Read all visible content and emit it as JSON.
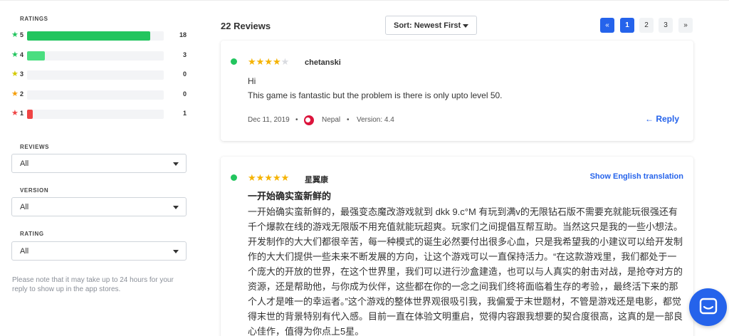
{
  "sidebar": {
    "ratings_label": "RATINGS",
    "ratings": [
      {
        "stars": "5",
        "count": "18",
        "fraction": 0.9,
        "color": "#22c55e"
      },
      {
        "stars": "4",
        "count": "3",
        "fraction": 0.13,
        "color": "#4ade80"
      },
      {
        "stars": "3",
        "count": "0",
        "fraction": 0,
        "color": "#facc15"
      },
      {
        "stars": "2",
        "count": "0",
        "fraction": 0,
        "color": "#fb923c"
      },
      {
        "stars": "1",
        "count": "1",
        "fraction": 0.04,
        "color": "#ef4444"
      }
    ],
    "filters": {
      "reviews": {
        "label": "REVIEWS",
        "value": "All"
      },
      "version": {
        "label": "VERSION",
        "value": "All"
      },
      "rating": {
        "label": "RATING",
        "value": "All"
      }
    },
    "note": "Please note that it may take up to 24 hours for your reply to show up in the app stores."
  },
  "main": {
    "reviews_count": "22 Reviews",
    "sort": "Sort: Newest First",
    "pagination": {
      "prev": "«",
      "pages": [
        "1",
        "2",
        "3"
      ],
      "next": "»",
      "current": "1"
    },
    "reviews": [
      {
        "rating": 4,
        "author": "chetanski",
        "title": "Hi",
        "body": "This game is fantastic but the problem is there is only upto level 50.",
        "date": "Dec 11, 2019",
        "country": "Nepal",
        "version": "Version: 4.4",
        "reply": "Reply"
      },
      {
        "rating": 5,
        "author": "星翼康",
        "translate": "Show English translation",
        "title": "一开始确实蛮新鲜的",
        "body": "一开始确实蛮新鲜的，最强变态魔改游戏就到 dkk 9.c°M 有玩到满v的无限钻石版不需要充就能玩很强还有千个爆款在线的游戏无限版不用充值就能玩超爽。玩家们之间提倡互帮互助。当然这只是我的一些小想法。开发制作的大大们都很辛苦，每一种模式的诞生必然要付出很多心血，只是我希望我的小建议可以给开发制作的大大们提供一些未来不断发展的方向，让这个游戏可以一直保持活力。“在这款游戏里，我们都处于一个庞大的开放的世界，在这个世界里，我们可以进行沙盒建造，也可以与人真实的射击对战，是抢夺对方的资源，还是帮助他，与你成为伙伴，这些都在你的一念之间我们终将面临着生存的考验，，最终活下来的那个人才是唯一的幸运者。”这个游戏的整体世界观很吸引我，我偏爱于末世题材，不管是游戏还是电影，都觉得末世的背景特别有代入感。目前一直在体验文明重启，觉得内容跟我想要的契合度很高，这真的是一部良心佳作，值得为你点上5星。"
      }
    ]
  },
  "icons": {
    "star": "star-icon",
    "chat": "chat-icon",
    "reply": "reply-arrow-icon",
    "flag": "flag-nepal-icon"
  },
  "colors": {
    "accent": "#2563eb",
    "online": "#22c55e",
    "star": "#f5b301"
  }
}
